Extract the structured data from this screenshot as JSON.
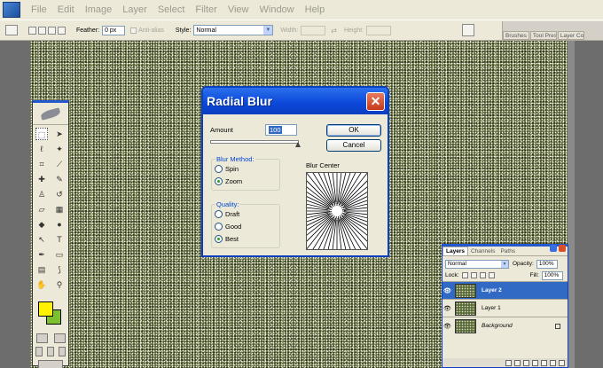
{
  "app": {
    "menu": [
      "File",
      "Edit",
      "Image",
      "Layer",
      "Select",
      "Filter",
      "View",
      "Window",
      "Help"
    ]
  },
  "options_bar": {
    "feather_label": "Feather:",
    "feather_value": "0 px",
    "antialias_label": "Anti-alias",
    "style_label": "Style:",
    "style_value": "Normal",
    "width_label": "Width:",
    "height_label": "Height:",
    "palette_tabs": [
      "Brushes",
      "Tool Presets",
      "Layer Comps"
    ]
  },
  "colors": {
    "foreground": "#fff200",
    "background": "#7cc030",
    "dialog_title_bar": "#0a46d8",
    "group_title": "#0046d5"
  },
  "dialog": {
    "title": "Radial Blur",
    "close_icon": "close-icon",
    "amount_label": "Amount",
    "amount_value": "100",
    "amount_fraction": 1.0,
    "ok_label": "OK",
    "cancel_label": "Cancel",
    "blur_method": {
      "title": "Blur Method:",
      "options": [
        "Spin",
        "Zoom"
      ],
      "selected": "Zoom"
    },
    "quality": {
      "title": "Quality:",
      "options": [
        "Draft",
        "Good",
        "Best"
      ],
      "selected": "Best"
    },
    "blur_center_label": "Blur Center"
  },
  "layers_panel": {
    "tabs": [
      "Layers",
      "Channels",
      "Paths"
    ],
    "blend_mode": "Normal",
    "opacity_label": "Opacity:",
    "opacity_value": "100%",
    "lock_label": "Lock:",
    "fill_label": "Fill:",
    "fill_value": "100%",
    "layers": [
      {
        "name": "Layer 2",
        "selected": true
      },
      {
        "name": "Layer 1",
        "selected": false
      },
      {
        "name": "Background",
        "selected": false,
        "locked": true
      }
    ]
  }
}
